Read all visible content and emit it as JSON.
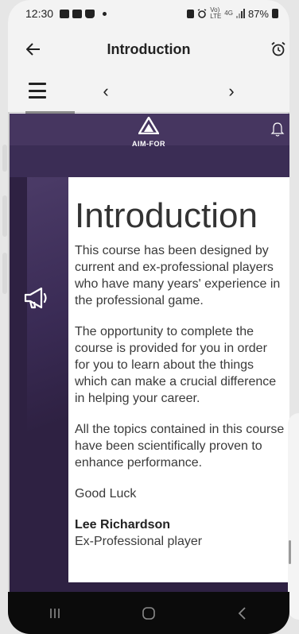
{
  "status_bar": {
    "time": "12:30",
    "battery_text": "87%",
    "network_top": "Vo)",
    "network_bottom": "LTE",
    "network_gen": "4G"
  },
  "header": {
    "title": "Introduction",
    "back_icon": "arrow-left-icon",
    "alarm_icon": "alarm-clock-icon"
  },
  "nav": {
    "menu_icon": "hamburger-menu-icon",
    "prev_label": "‹",
    "next_label": "›"
  },
  "brand": {
    "logo_text": "AIM-FOR",
    "bell_icon": "bell-icon"
  },
  "content": {
    "title": "Introduction",
    "paragraphs": [
      "This course has been designed by current and ex-professional players who have many years' experience in the professional game.",
      "The opportunity to complete the course is provided for you in order for you to learn about the things which can make a crucial difference in helping your career.",
      "All the topics contained in this course have been scientifically proven to enhance performance.",
      "Good Luck"
    ],
    "author_name": "Lee Richardson",
    "author_role": "Ex-Professional player"
  },
  "colors": {
    "brand_purple": "#463660",
    "dark_purple": "#2e2142"
  }
}
